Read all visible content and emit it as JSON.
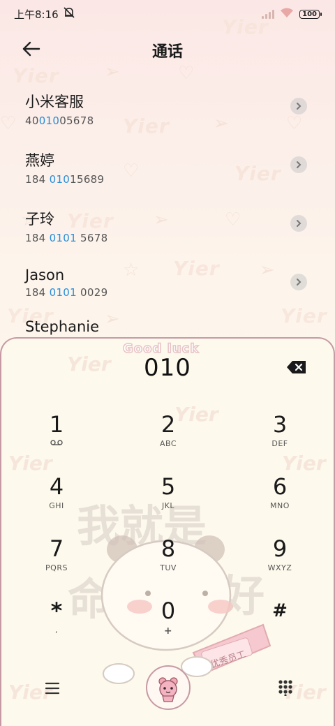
{
  "status_bar": {
    "time": "上午8:16",
    "battery": "100"
  },
  "header": {
    "title": "通话"
  },
  "contacts": [
    {
      "name": "小米客服",
      "number_pre": "40",
      "number_hl": "010",
      "number_post": "05678"
    },
    {
      "name": "燕婷",
      "number_pre": "184 ",
      "number_hl": "010",
      "number_post": "15689"
    },
    {
      "name": "子玲",
      "number_pre": "184 ",
      "number_hl": "0101",
      "number_post": " 5678"
    },
    {
      "name": "Jason",
      "number_pre": "184 ",
      "number_hl": "0101",
      "number_post": " 0029"
    },
    {
      "name": "Stephanie"
    }
  ],
  "dialpad": {
    "input": "010",
    "decor_text": "Good luck",
    "keys": [
      {
        "digit": "1",
        "letters": ""
      },
      {
        "digit": "2",
        "letters": "ABC"
      },
      {
        "digit": "3",
        "letters": "DEF"
      },
      {
        "digit": "4",
        "letters": "GHI"
      },
      {
        "digit": "5",
        "letters": "JKL"
      },
      {
        "digit": "6",
        "letters": "MNO"
      },
      {
        "digit": "7",
        "letters": "PQRS"
      },
      {
        "digit": "8",
        "letters": "TUV"
      },
      {
        "digit": "9",
        "letters": "WXYZ"
      },
      {
        "digit": "*",
        "letters": ","
      },
      {
        "digit": "0",
        "letters": "+"
      },
      {
        "digit": "#",
        "letters": ""
      }
    ],
    "art_text": {
      "top": "我就是",
      "left": "命",
      "right": "好",
      "badge": "优秀员工"
    }
  },
  "icons": {
    "back": "arrow-left-icon",
    "voicemail": "voicemail-icon",
    "backspace": "backspace-icon",
    "menu": "menu-icon",
    "keypad": "keypad-grid-icon",
    "call": "call-icon",
    "mute": "bell-off-icon",
    "wifi": "wifi-icon",
    "signal": "signal-icon"
  },
  "colors": {
    "highlight": "#2a8ed8",
    "panel_border": "#c69aa4",
    "background_top": "#fbe8e6",
    "background_bottom": "#fdf8ee"
  }
}
